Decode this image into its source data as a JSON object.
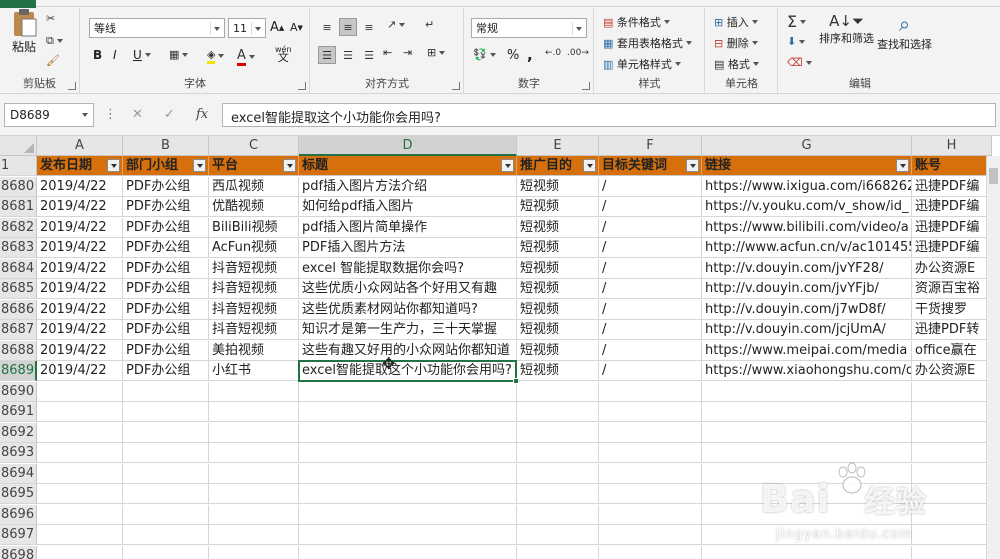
{
  "ribbon": {
    "clipboard": {
      "paste": "粘贴",
      "group": "剪贴板"
    },
    "font": {
      "name": "等线",
      "size": "11",
      "group": "字体",
      "bold": "B",
      "italic": "I",
      "underline": "U",
      "grow": "A",
      "shrink": "A",
      "wen": "wén"
    },
    "align": {
      "group": "对齐方式"
    },
    "number": {
      "format": "常规",
      "percent": "%",
      "comma": ",",
      "group": "数字"
    },
    "styles": {
      "conditional": "条件格式",
      "table": "套用表格格式",
      "cell": "单元格样式",
      "group": "样式"
    },
    "cells": {
      "insert": "插入",
      "delete": "删除",
      "format": "格式",
      "group": "单元格"
    },
    "editing": {
      "sort": "排序和筛选",
      "find": "查找和选择",
      "group": "编辑"
    }
  },
  "formula_bar": {
    "name_box": "D8689",
    "cancel": "✕",
    "enter": "✓",
    "fx": "fx",
    "content": "excel智能提取这个小功能你会用吗?"
  },
  "grid": {
    "columns": [
      "A",
      "B",
      "C",
      "D",
      "E",
      "F",
      "G",
      "H"
    ],
    "active_column": "D",
    "active_row": "8689",
    "header_row_number": "1",
    "headers": [
      "发布日期",
      "部门小组",
      "平台",
      "标题",
      "推广目的",
      "目标关键词",
      "链接",
      "账号"
    ],
    "rows": [
      {
        "n": "8680",
        "cells": [
          "2019/4/22",
          "PDF办公组",
          "西瓜视频",
          "pdf插入图片方法介绍",
          "短视频",
          "/",
          "https://www.ixigua.com/i668262",
          "迅捷PDF编"
        ]
      },
      {
        "n": "8681",
        "cells": [
          "2019/4/22",
          "PDF办公组",
          "优酷视频",
          "如何给pdf插入图片",
          "短视频",
          "/",
          "https://v.youku.com/v_show/id_",
          "迅捷PDF编"
        ]
      },
      {
        "n": "8682",
        "cells": [
          "2019/4/22",
          "PDF办公组",
          "BiliBili视频",
          "pdf插入图片简单操作",
          "短视频",
          "/",
          "https://www.bilibili.com/video/a",
          "迅捷PDF编"
        ]
      },
      {
        "n": "8683",
        "cells": [
          "2019/4/22",
          "PDF办公组",
          "AcFun视频",
          "PDF插入图片方法",
          "短视频",
          "/",
          "http://www.acfun.cn/v/ac101455",
          "迅捷PDF编"
        ]
      },
      {
        "n": "8684",
        "cells": [
          "2019/4/22",
          "PDF办公组",
          "抖音短视频",
          "excel 智能提取数据你会吗?",
          "短视频",
          "/",
          "http://v.douyin.com/jvYF28/",
          "办公资源E"
        ]
      },
      {
        "n": "8685",
        "cells": [
          "2019/4/22",
          "PDF办公组",
          "抖音短视频",
          "这些优质小众网站各个好用又有趣",
          "短视频",
          "/",
          "http://v.douyin.com/jvYFjb/",
          "资源百宝裕"
        ]
      },
      {
        "n": "8686",
        "cells": [
          "2019/4/22",
          "PDF办公组",
          "抖音短视频",
          "这些优质素材网站你都知道吗?",
          "短视频",
          "/",
          "http://v.douyin.com/j7wD8f/",
          "干货搜罗"
        ]
      },
      {
        "n": "8687",
        "cells": [
          "2019/4/22",
          "PDF办公组",
          "抖音短视频",
          "知识才是第一生产力，三十天掌握",
          "短视频",
          "/",
          "http://v.douyin.com/jcjUmA/",
          "迅捷PDF转"
        ]
      },
      {
        "n": "8688",
        "cells": [
          "2019/4/22",
          "PDF办公组",
          "美拍视频",
          "这些有趣又好用的小众网站你都知道",
          "短视频",
          "/",
          "https://www.meipai.com/media",
          "office赢在"
        ]
      },
      {
        "n": "8689",
        "cells": [
          "2019/4/22",
          "PDF办公组",
          "小红书",
          "excel智能提取这个小功能你会用吗?",
          "短视频",
          "/",
          "https://www.xiaohongshu.com/d",
          "办公资源E"
        ]
      }
    ],
    "empty_rows": [
      "8690",
      "8691",
      "8692",
      "8693",
      "8694",
      "8695",
      "8696",
      "8697",
      "8698"
    ]
  },
  "watermark": {
    "logo": "Bai",
    "cn": "经验",
    "sub": "jingyan.baidu.com"
  },
  "colors": {
    "header_fill": "#d6700c",
    "accent": "#217346"
  }
}
